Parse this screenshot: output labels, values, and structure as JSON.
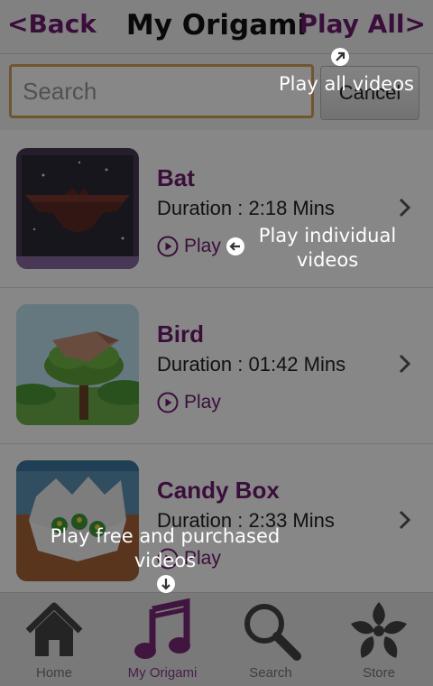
{
  "header": {
    "back_label": "<Back",
    "title": "My Origami",
    "play_all_label": "Play All>"
  },
  "search": {
    "placeholder": "Search",
    "value": "",
    "cancel_label": "Cancel"
  },
  "videos": [
    {
      "name": "Bat",
      "duration": "Duration : 2:18 Mins",
      "play_label": "Play"
    },
    {
      "name": "Bird",
      "duration": "Duration : 01:42 Mins",
      "play_label": "Play"
    },
    {
      "name": "Candy Box",
      "duration": "Duration : 2:33 Mins",
      "play_label": "Play"
    }
  ],
  "tabbar": {
    "tabs": [
      {
        "label": "Home"
      },
      {
        "label": "My Origami"
      },
      {
        "label": "Search"
      },
      {
        "label": "Store"
      }
    ],
    "active": "My Origami"
  },
  "tooltips": {
    "play_all": "Play all videos",
    "play_individual": "Play individual videos",
    "play_free_purchased": "Play free and purchased videos"
  },
  "colors": {
    "accent": "#6e1c6e",
    "search_border": "#d4a259",
    "overlay": "rgba(0,0,0,0.47)"
  }
}
